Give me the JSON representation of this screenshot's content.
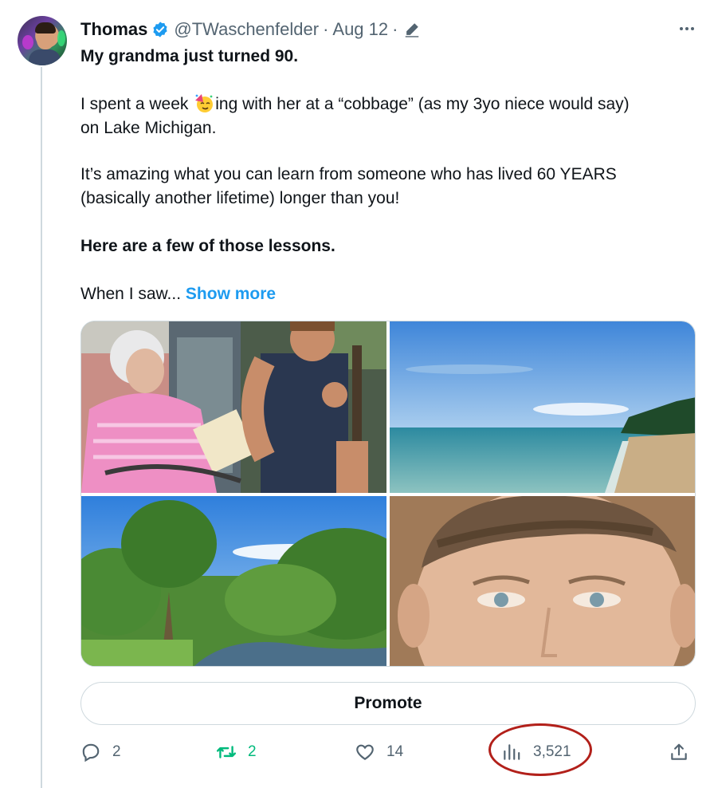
{
  "author": {
    "name": "Thomas",
    "handle": "@TWaschenfelder",
    "date": "Aug 12",
    "separator": "·"
  },
  "tweet": {
    "line1": "My grandma just turned 90.",
    "line2_before_emoji": "I spent a week ",
    "line2_after_emoji": "ing with her at a “cobbage” (as my 3yo niece would say)",
    "line3": "on Lake Michigan.",
    "line4": "It’s amazing what you can learn from someone who has lived 60 YEARS",
    "line5": "(basically another lifetime) longer than you!",
    "line6": "Here are a few of those lessons.",
    "line7": "When I saw...",
    "show_more": "Show more",
    "emoji": "partying-face-emoji"
  },
  "media": [
    {
      "name": "photo-grandma-and-grandson"
    },
    {
      "name": "photo-lake-michigan-beach"
    },
    {
      "name": "photo-river-and-trees"
    },
    {
      "name": "photo-vintage-soldier-portrait"
    }
  ],
  "promote_label": "Promote",
  "actions": {
    "replies": "2",
    "retweets": "2",
    "likes": "14",
    "views": "3,521"
  },
  "colors": {
    "accent": "#1d9bf0",
    "retweet": "#00ba7c",
    "annotation_circle": "#b2201a",
    "muted_text": "#536471"
  },
  "icons": [
    "verified-badge-icon",
    "edit-icon",
    "more-icon",
    "reply-icon",
    "retweet-icon",
    "like-icon",
    "views-icon",
    "share-icon"
  ]
}
